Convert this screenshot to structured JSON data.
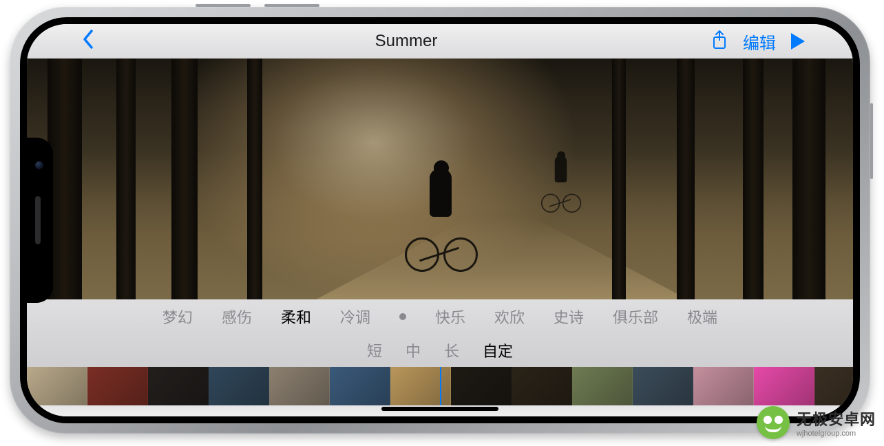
{
  "nav": {
    "title": "Summer",
    "edit_label": "编辑"
  },
  "moods": {
    "items": [
      "梦幻",
      "感伤",
      "柔和",
      "冷调",
      "快乐",
      "欢欣",
      "史诗",
      "俱乐部",
      "极端"
    ],
    "active_index": 2,
    "dot_after_index": 3
  },
  "durations": {
    "items": [
      "短",
      "中",
      "长",
      "自定"
    ],
    "active_index": 3
  },
  "thumbnails": {
    "count": 14,
    "colors": [
      "#b9a98a",
      "#7a2e24",
      "#221f1c",
      "#30475a",
      "#8c8070",
      "#3a5a7a",
      "#b9965a",
      "#1d1a14",
      "#2a2318",
      "#6e7b52",
      "#3b4c5a",
      "#c48f9d",
      "#e64aa8",
      "#3a2f22"
    ]
  },
  "watermark": {
    "title": "无极安卓网",
    "url": "wjhotelgroup.com"
  },
  "colors": {
    "accent": "#007aff"
  }
}
